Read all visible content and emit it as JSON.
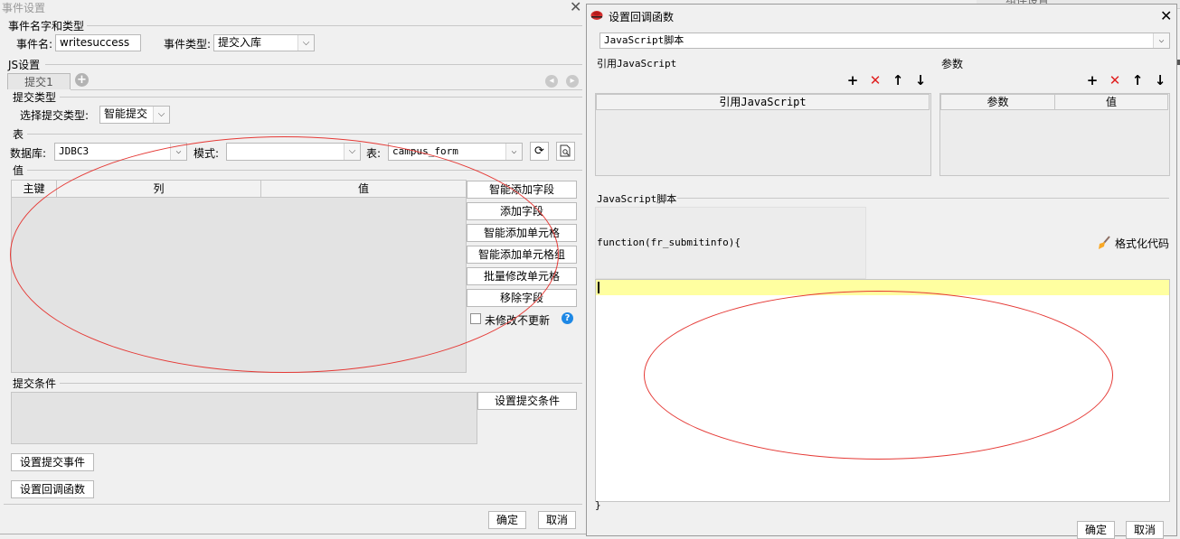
{
  "event_dialog": {
    "title": "事件设置",
    "section_name_type": "事件名字和类型",
    "event_name_label": "事件名:",
    "event_name_value": "writesuccess",
    "event_type_label": "事件类型:",
    "event_type_value": "提交入库",
    "js_settings": "JS设置",
    "tab_label": "提交1",
    "submit_type_section": "提交类型",
    "choose_submit_type_label": "选择提交类型:",
    "choose_submit_type_value": "智能提交",
    "table_section": "表",
    "db_label": "数据库:",
    "db_value": "JDBC3",
    "mode_label": "模式:",
    "mode_value": "",
    "table_label": "表:",
    "table_value": "campus_form",
    "value_section": "值",
    "columns": [
      "主键",
      "列",
      "值"
    ],
    "side_buttons": [
      "智能添加字段",
      "添加字段",
      "智能添加单元格",
      "智能添加单元格组",
      "批量修改单元格",
      "移除字段"
    ],
    "no_update_label": "未修改不更新",
    "submit_condition_section": "提交条件",
    "set_condition_button": "设置提交条件",
    "set_submit_event_button": "设置提交事件",
    "set_callback_button": "设置回调函数",
    "ok_button": "确定",
    "cancel_button": "取消"
  },
  "callback_dialog": {
    "title": "设置回调函数",
    "script_type_value": "JavaScript脚本",
    "ref_js_section": "引用JavaScript",
    "params_section": "参数",
    "ref_js_column": "引用JavaScript",
    "param_columns": [
      "参数",
      "值"
    ],
    "js_script_section": "JavaScript脚本",
    "function_header": "function(fr_submitinfo){",
    "function_footer": "}",
    "format_code_button": "格式化代码",
    "ok_button": "确定",
    "cancel_button": "取消"
  },
  "background": {
    "partial_text": "组件设置"
  },
  "colors": {
    "annotation": "#e53935",
    "editor_highlight": "#ffffa0",
    "help_blue": "#1e88e5",
    "delete_red": "#e02020"
  }
}
